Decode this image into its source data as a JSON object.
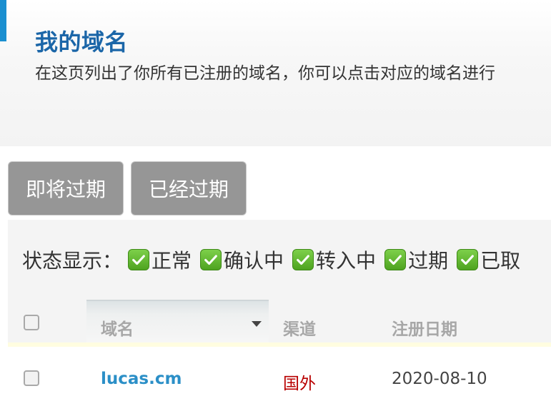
{
  "header": {
    "title": "我的域名",
    "description": "在这页列出了你所有已注册的域名，你可以点击对应的域名进行"
  },
  "tabs": [
    {
      "label": "即将过期"
    },
    {
      "label": "已经过期"
    }
  ],
  "status_filter": {
    "label": "状态显示：",
    "items": [
      {
        "label": "正常",
        "checked": true
      },
      {
        "label": "确认中",
        "checked": true
      },
      {
        "label": "转入中",
        "checked": true
      },
      {
        "label": "过期",
        "checked": true
      },
      {
        "label": "已取",
        "checked": true
      }
    ],
    "check_color": "#5cb82e"
  },
  "table": {
    "columns": [
      "域名",
      "渠道",
      "注册日期"
    ],
    "rows": [
      {
        "domain": "lucas.cm",
        "channel": "国外",
        "reg_date": "2020-08-10"
      }
    ]
  },
  "colors": {
    "accent": "#1a8fd0",
    "title": "#1b66a8",
    "link": "#2b8fc7",
    "channel": "#b80000"
  }
}
